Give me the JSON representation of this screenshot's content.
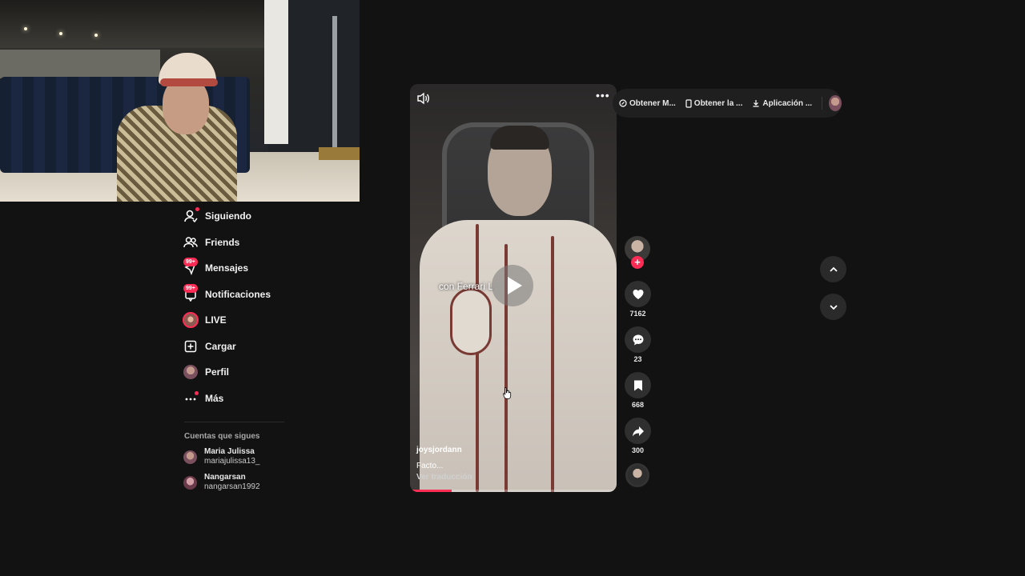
{
  "sidebar": {
    "items": [
      {
        "label": "Siguiendo",
        "icon": "following-icon",
        "badge": ""
      },
      {
        "label": "Friends",
        "icon": "friends-icon",
        "badge": ""
      },
      {
        "label": "Mensajes",
        "icon": "messages-icon",
        "badge": "99+"
      },
      {
        "label": "Notificaciones",
        "icon": "notifications-icon",
        "badge": "99+"
      },
      {
        "label": "LIVE",
        "icon": "live-icon",
        "badge": ""
      },
      {
        "label": "Cargar",
        "icon": "upload-icon",
        "badge": ""
      },
      {
        "label": "Perfil",
        "icon": "profile-avatar",
        "badge": ""
      },
      {
        "label": "Más",
        "icon": "more-icon",
        "badge": ""
      }
    ],
    "following_title": "Cuentas que sigues",
    "accounts": [
      {
        "name": "Maria Julissa",
        "handle": "mariajulissa13_"
      },
      {
        "name": "Nangarsan",
        "handle": "nangarsan1992"
      }
    ]
  },
  "video": {
    "caption_overlay": "con Ferrari L",
    "author": "joysjordann",
    "description": "Facto...",
    "translate": "Ver traducción",
    "progress": 0.2
  },
  "actions": {
    "likes": "7162",
    "comments": "23",
    "saves": "668",
    "shares": "300"
  },
  "topbar": {
    "items": [
      "Obtener M...",
      "Obtener la ...",
      "Aplicación ..."
    ]
  },
  "colors": {
    "accent": "#fe2c55",
    "background": "#121212"
  }
}
